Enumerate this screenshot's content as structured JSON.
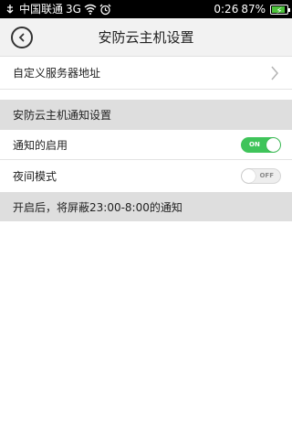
{
  "status_bar": {
    "carrier": "中国联通",
    "network": "3G",
    "time": "0:26",
    "battery_percent": "87%",
    "battery_level": 0.87,
    "icons": [
      "usb-icon",
      "wifi-icon",
      "alarm-icon",
      "battery-icon"
    ]
  },
  "header": {
    "title": "安防云主机设置",
    "back_icon": "back-arrow-icon"
  },
  "settings": {
    "server_address_label": "自定义服务器地址",
    "notification_section_title": "安防云主机通知设置",
    "enable_notifications": {
      "label": "通知的启用",
      "state_label": "ON",
      "on": true
    },
    "night_mode": {
      "label": "夜间模式",
      "state_label": "OFF",
      "on": false
    },
    "night_mode_note": "开启后，将屏蔽23:00-8:00的通知"
  },
  "colors": {
    "toggle_on": "#3fc45a",
    "section_background": "#dedede",
    "header_background": "#f2f2f2"
  }
}
